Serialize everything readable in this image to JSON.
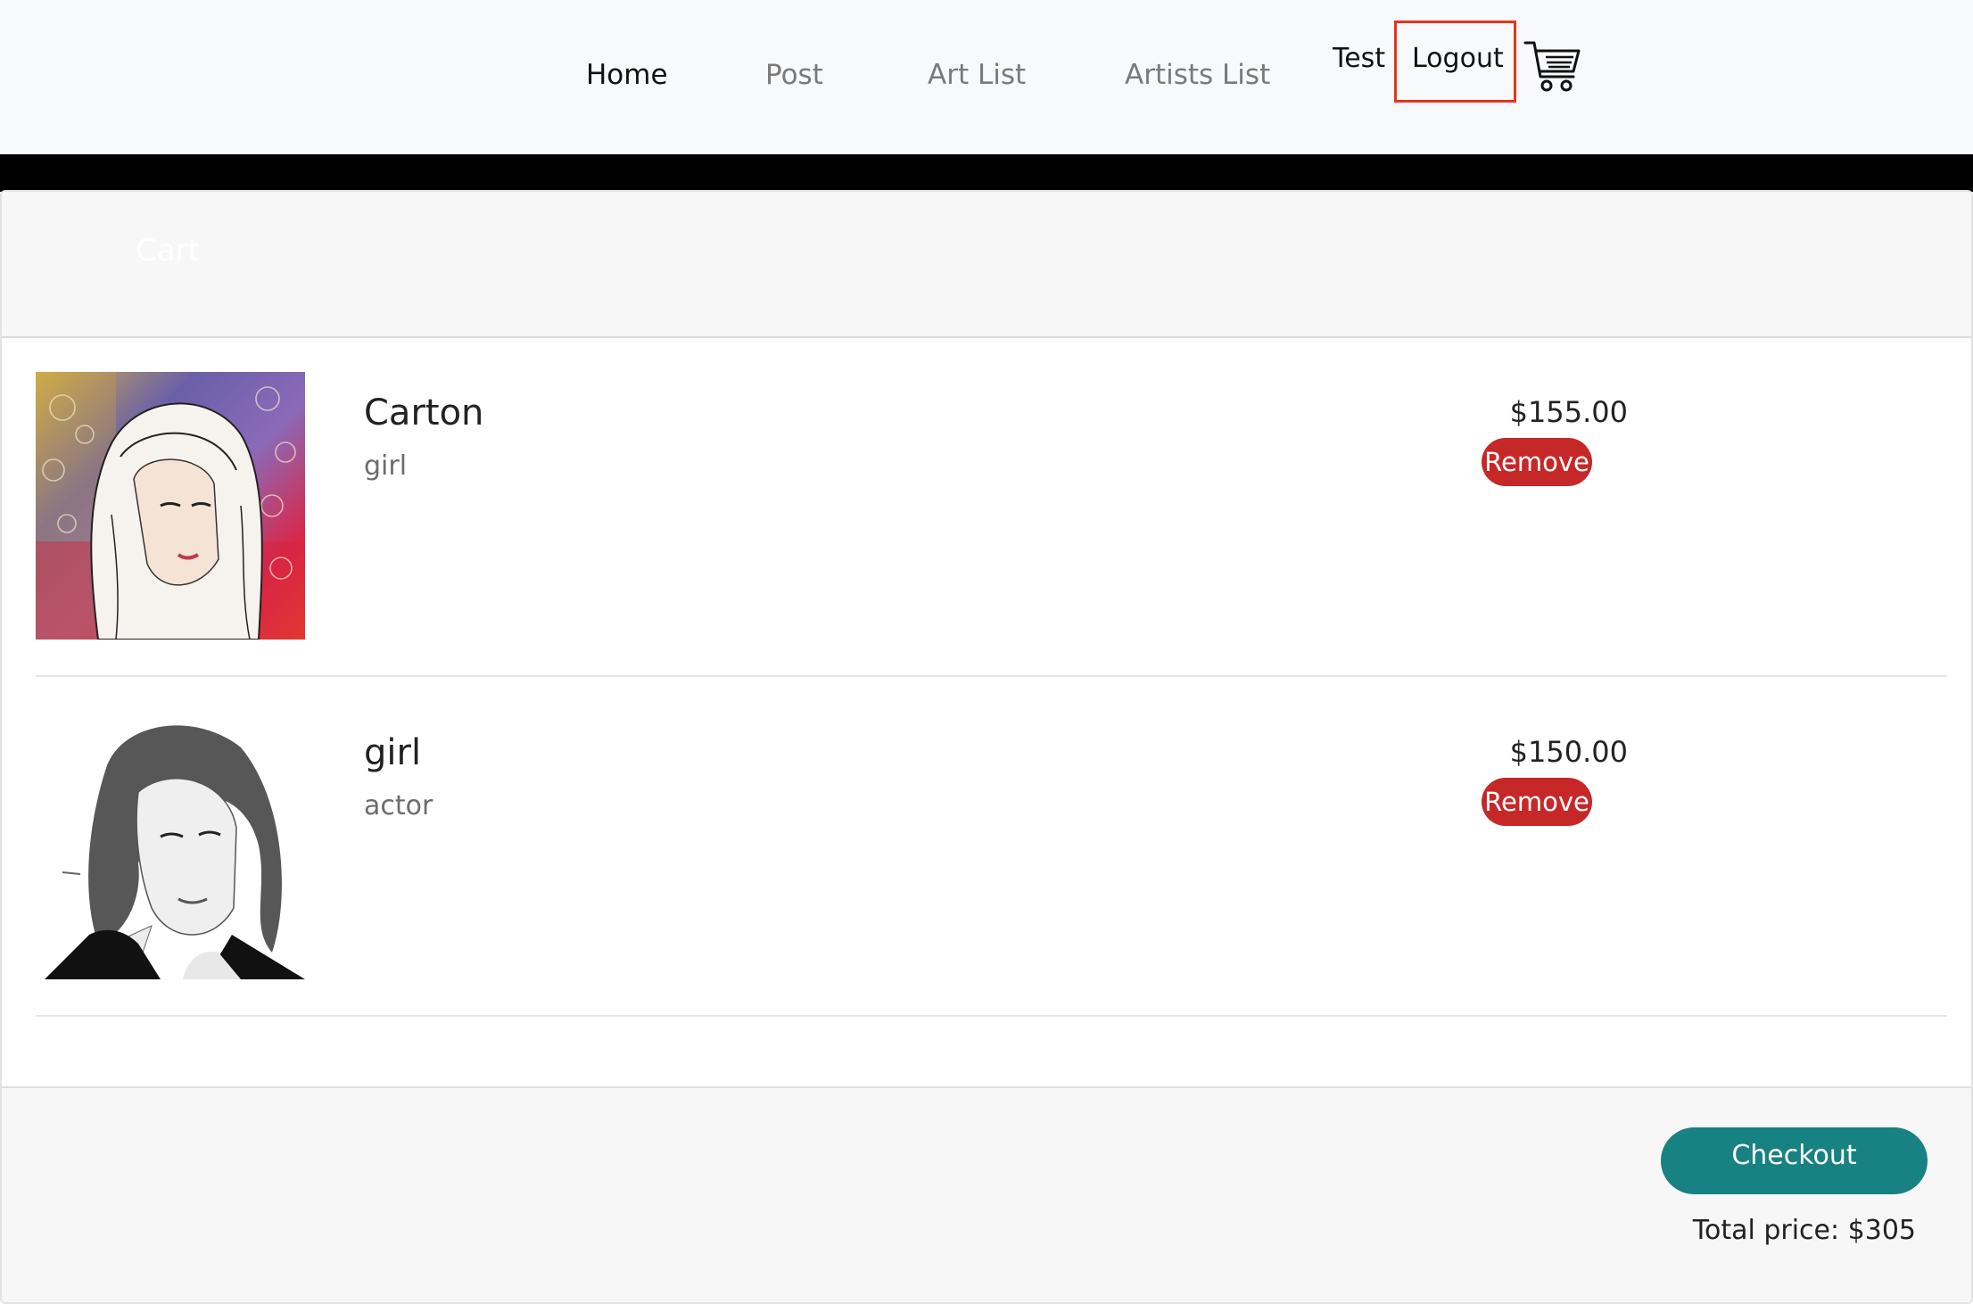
{
  "nav": {
    "links": [
      "Home",
      "Post",
      "Art List",
      "Artists List"
    ],
    "user_name": "Test",
    "logout_label": "Logout"
  },
  "cart": {
    "title": "Cart",
    "items": [
      {
        "name": "Carton",
        "description": "girl",
        "price": "$155.00",
        "remove_label": "Remove"
      },
      {
        "name": "girl",
        "description": "actor",
        "price": "$150.00",
        "remove_label": "Remove"
      }
    ],
    "checkout_label": "Checkout",
    "total_label": "Total price: $305"
  },
  "colors": {
    "remove_button": "#c62828",
    "checkout_button": "#188181",
    "highlight_box": "#e8321e"
  },
  "icons": {
    "cart": "shopping-cart-icon"
  }
}
